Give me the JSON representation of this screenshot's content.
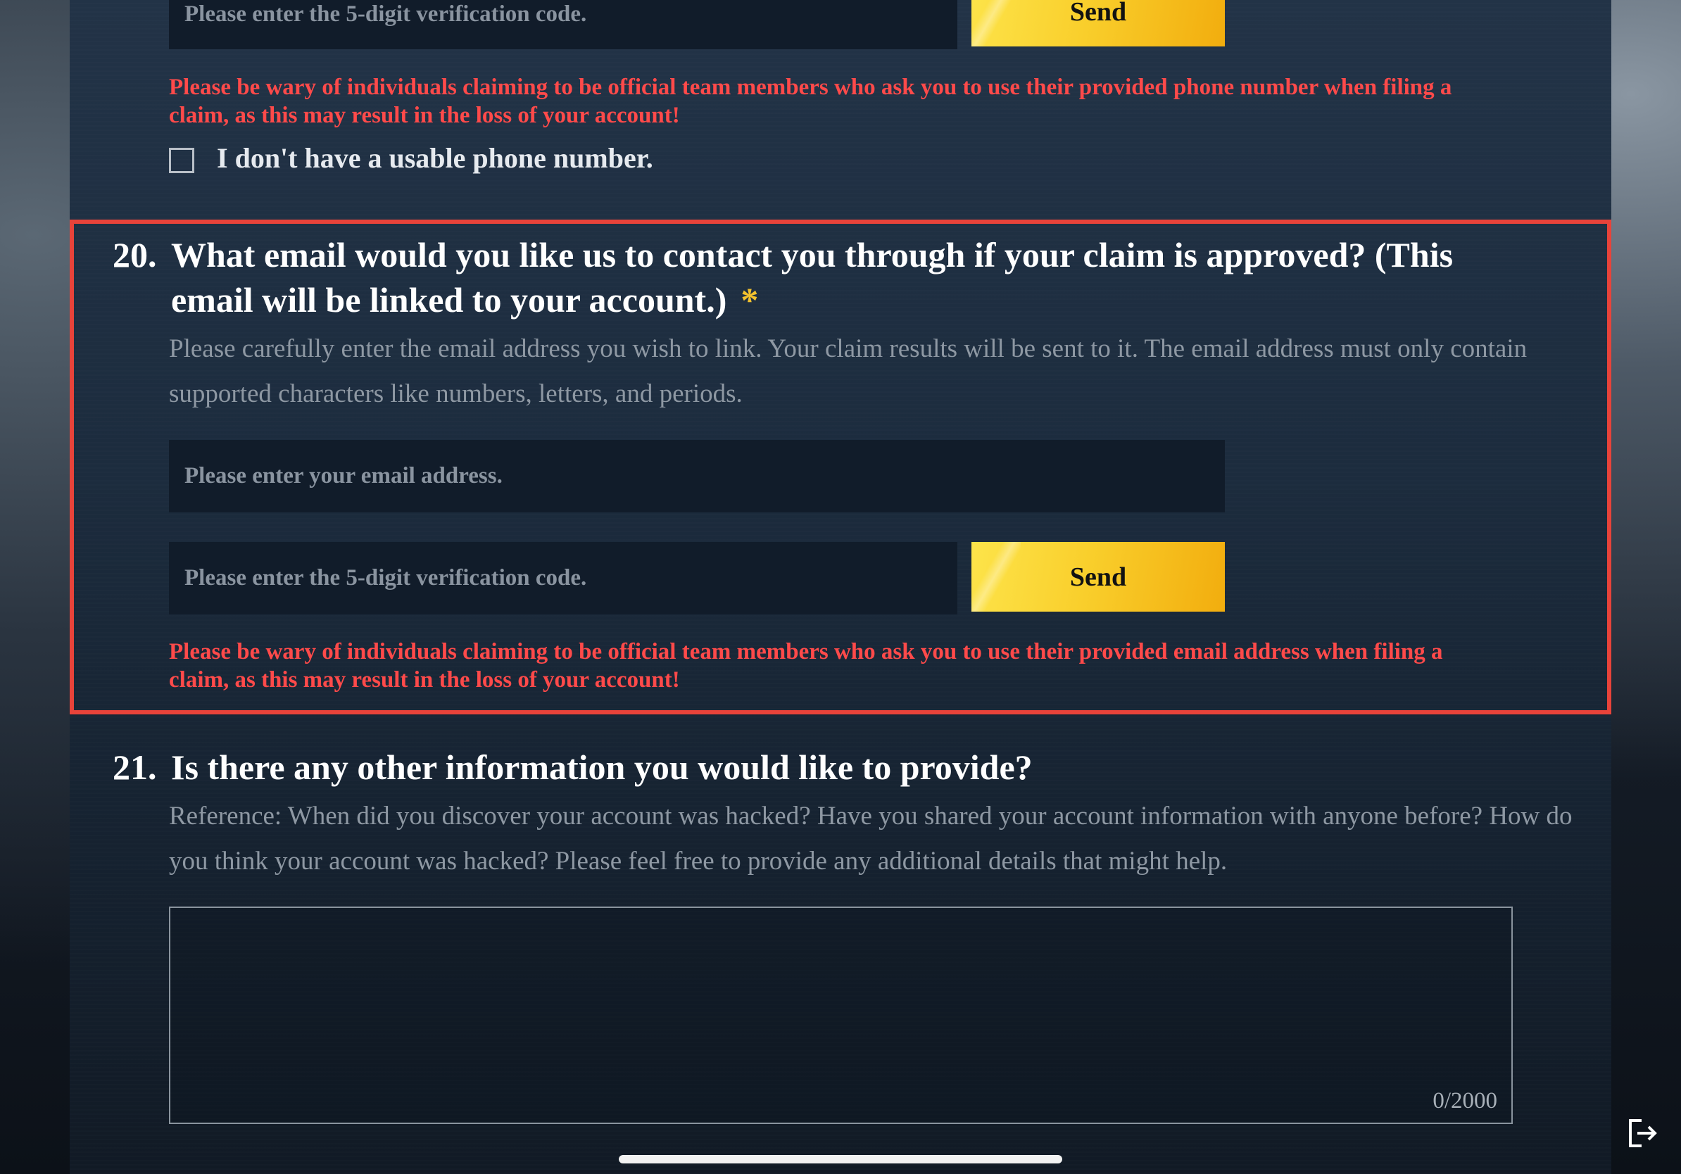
{
  "prev_section": {
    "code_placeholder": "Please enter the 5-digit verification code.",
    "send_label": "Send",
    "warning": "Please be wary of individuals claiming to be official team members who ask you to use their provided phone number when filing a claim, as this may result in the loss of your account!",
    "no_phone_label": "I don't have a usable phone number."
  },
  "q20": {
    "number": "20.",
    "title": "What email would you like us to contact you through if your claim is approved? (This email will be linked to your account.)",
    "required_mark": "*",
    "description": "Please carefully enter the email address you wish to link. Your claim results will be sent to it. The email address must only contain supported characters like numbers, letters, and periods.",
    "email_placeholder": "Please enter your email address.",
    "code_placeholder": "Please enter the 5-digit verification code.",
    "send_label": "Send",
    "warning": "Please be wary of individuals claiming to be official team members who ask you to use their provided email address when filing a claim, as this may result in the loss of your account!"
  },
  "q21": {
    "number": "21.",
    "title": "Is there any other information you would like to provide?",
    "description": "Reference: When did you discover your account was hacked? Have you shared your account information with anyone before? How do you think your account was hacked? Please feel free to provide any additional details that might help.",
    "char_counter": "0/2000"
  },
  "icons": {
    "exit": "exit-icon"
  },
  "colors": {
    "accent_gold": "#f9cf2c",
    "warning_red": "#ff4a4a",
    "highlight_border": "#e8433a"
  }
}
